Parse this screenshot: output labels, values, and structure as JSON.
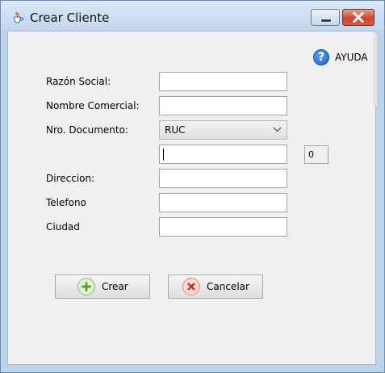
{
  "window": {
    "title": "Crear Cliente",
    "icon": "java-cup-icon",
    "controls": [
      "minimize-icon",
      "close-icon"
    ]
  },
  "help": {
    "label": "AYUDA",
    "icon": "help-icon"
  },
  "form": {
    "razon_social_label": "Razón Social:",
    "razon_social_value": "",
    "nombre_comercial_label": "Nombre Comercial:",
    "nombre_comercial_value": "",
    "nro_documento_label": "Nro. Documento:",
    "documento_tipo_selected": "RUC",
    "documento_numero_value": "",
    "documento_counter": "0",
    "direccion_label": "Direccion:",
    "direccion_value": "",
    "telefono_label": "Telefono",
    "telefono_value": "",
    "ciudad_label": "Ciudad",
    "ciudad_value": ""
  },
  "actions": {
    "crear_label": "Crear",
    "crear_icon": "plus-icon",
    "cancelar_label": "Cancelar",
    "cancelar_icon": "cancel-icon"
  },
  "colors": {
    "accent_green": "#5aa02c",
    "accent_red": "#d42a1f",
    "help_blue": "#1a5fc6"
  }
}
